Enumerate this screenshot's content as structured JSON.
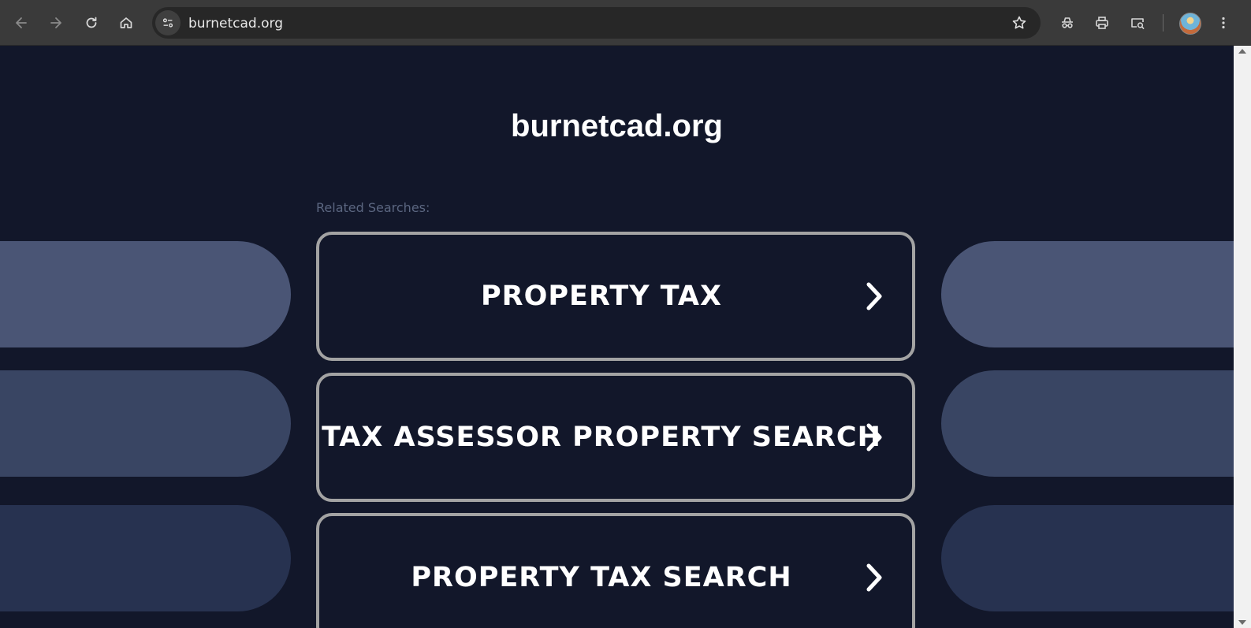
{
  "browser": {
    "url": "burnetcad.org",
    "icons": {
      "back": "back-arrow-icon",
      "forward": "forward-arrow-icon",
      "reload": "reload-icon",
      "home": "home-icon",
      "site_info": "site-info-tune-icon",
      "bookmark": "star-icon",
      "incognito": "incognito-icon",
      "print": "printer-icon",
      "search_page": "search-page-icon",
      "menu": "more-vertical-icon"
    }
  },
  "page": {
    "title": "burnetcad.org",
    "related_label": "Related Searches:",
    "searches": [
      {
        "label": "PROPERTY TAX"
      },
      {
        "label": "TAX ASSESSOR PROPERTY SEARCH"
      },
      {
        "label": "PROPERTY TAX SEARCH"
      }
    ]
  },
  "colors": {
    "background": "#12172a",
    "card_border": "#a3a3a3",
    "deco_row1": "#4a5575",
    "deco_row2": "#394563",
    "deco_row3": "#273250",
    "muted_text": "#5b6680"
  }
}
